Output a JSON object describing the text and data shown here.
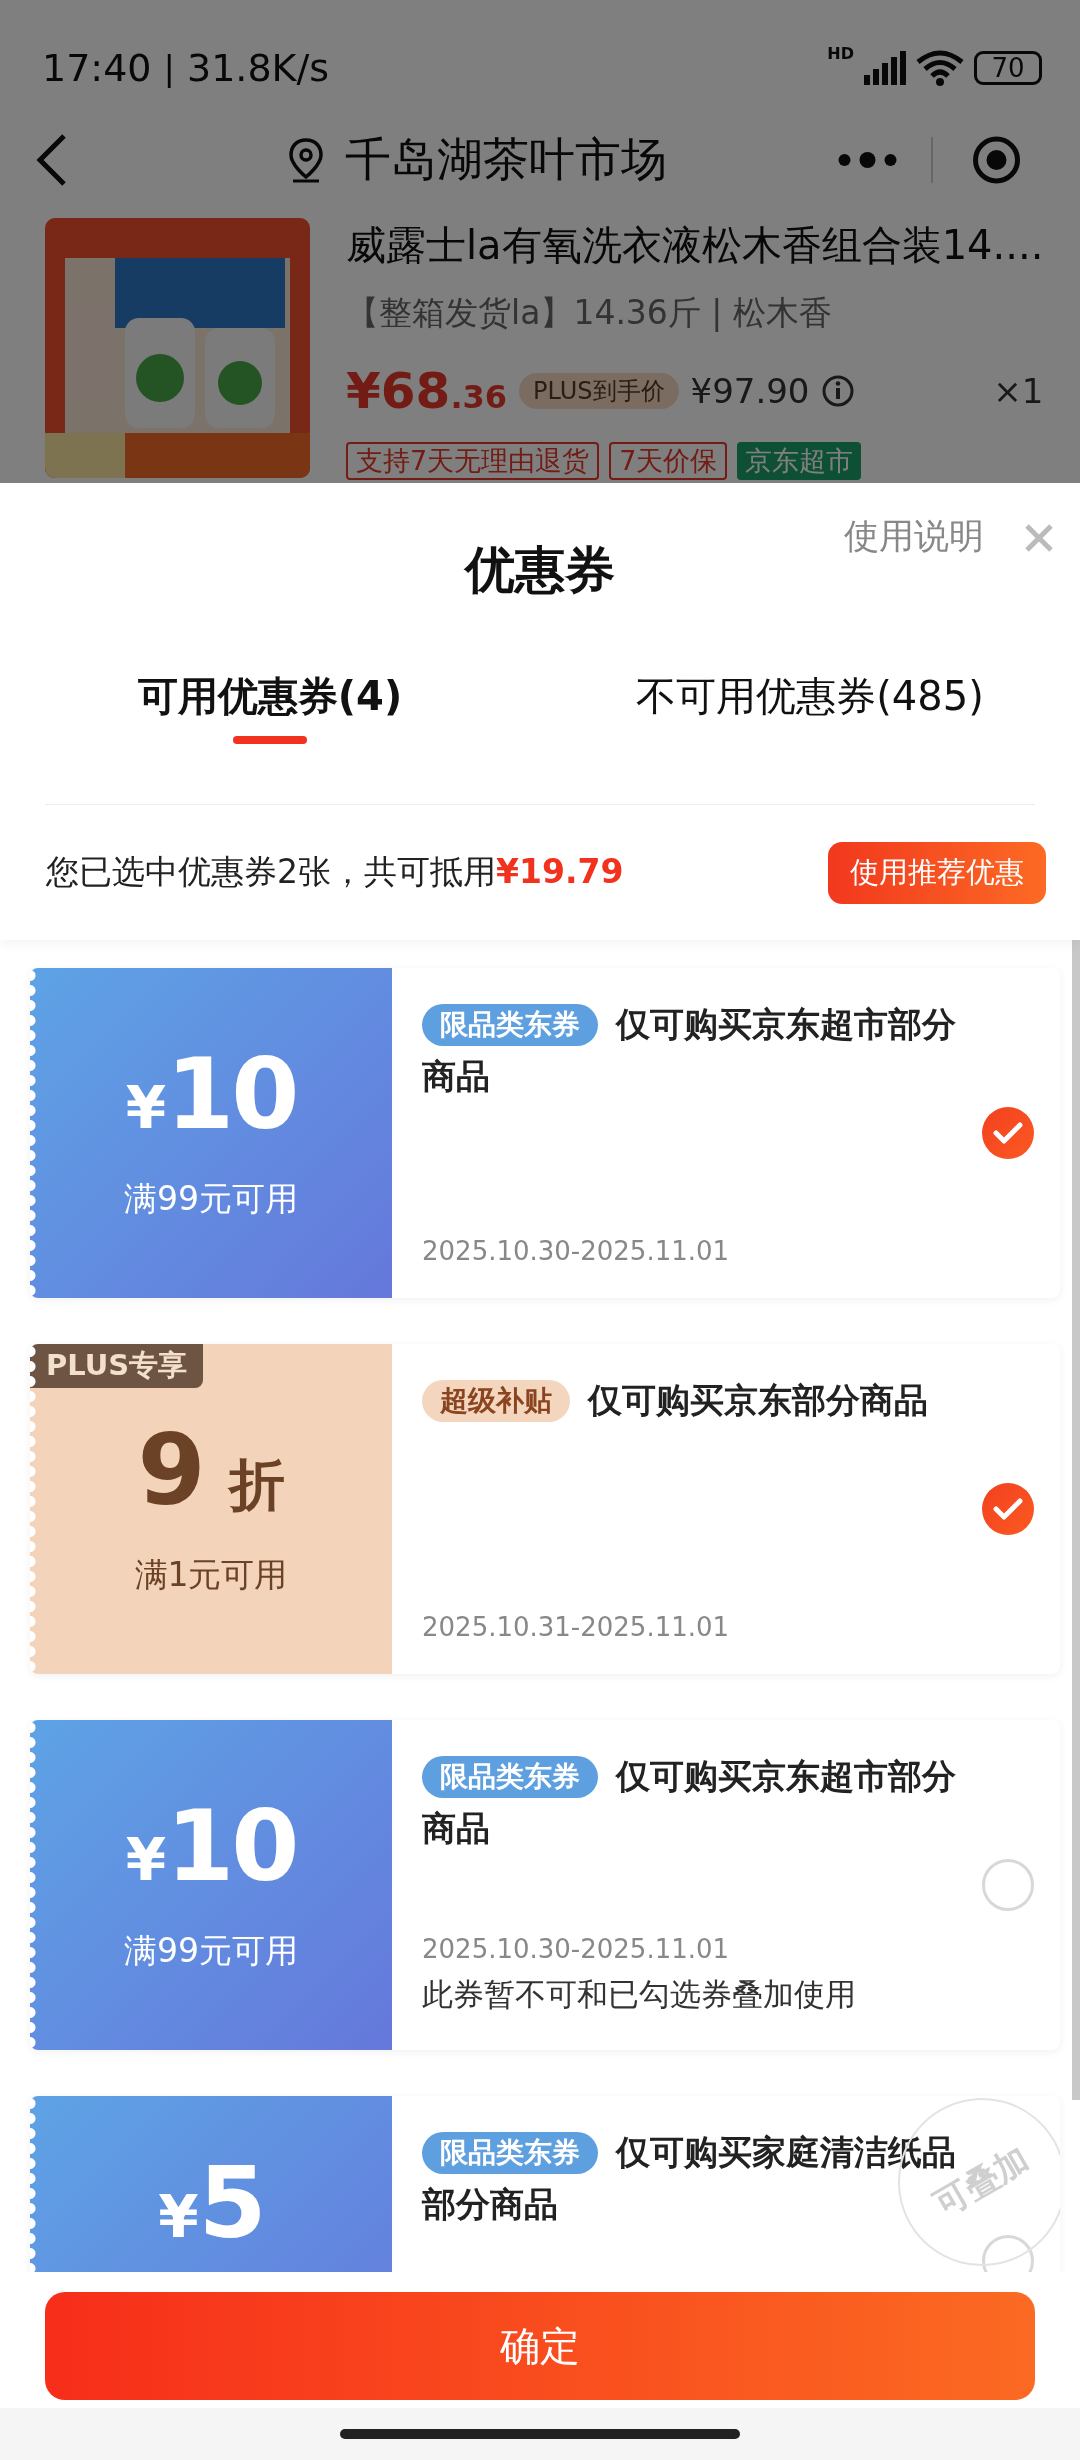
{
  "status_bar": {
    "time": "17:40",
    "separator": "|",
    "speed": "31.8K/s",
    "network_label": "HD",
    "battery": "70"
  },
  "nav": {
    "location": "千岛湖茶叶市场"
  },
  "product": {
    "title": "威露士la有氧洗衣液松木香组合装14....",
    "spec": "【整箱发货la】14.36斤 | 松木香",
    "price": "¥68",
    "price_decimal": ".36",
    "price_label": "PLUS到手价",
    "original_price": "¥97.90",
    "quantity": "×1",
    "tags": [
      {
        "text": "支持7天无理由退货",
        "kind": "outline"
      },
      {
        "text": "7天价保",
        "kind": "outline"
      },
      {
        "text": "京东超市",
        "kind": "filled"
      }
    ]
  },
  "sheet": {
    "title": "优惠券",
    "help": "使用说明",
    "tabs": [
      {
        "label": "可用优惠券(4)",
        "selected": true
      },
      {
        "label": "不可用优惠券(485)",
        "selected": false
      }
    ],
    "summary": {
      "text": "您已选中优惠券2张，共可抵用",
      "amount": "¥19.79",
      "button": "使用推荐优惠"
    }
  },
  "coupons": [
    {
      "kind": "cash",
      "symbol": "¥",
      "value": "10",
      "condition": "满99元可用",
      "tag": {
        "text": "限品类东券",
        "kind": "category"
      },
      "title": "仅可购买京东超市部分商品",
      "date": "2025.10.30-2025.11.01",
      "checked": true
    },
    {
      "kind": "discount",
      "badge": "PLUS专享",
      "value": "9",
      "unit": "折",
      "condition": "满1元可用",
      "tag": {
        "text": "超级补贴",
        "kind": "subsidy"
      },
      "title": "仅可购买京东部分商品",
      "date": "2025.10.31-2025.11.01",
      "checked": true
    },
    {
      "kind": "cash",
      "symbol": "¥",
      "value": "10",
      "condition": "满99元可用",
      "tag": {
        "text": "限品类东券",
        "kind": "category"
      },
      "title": "仅可购买京东超市部分商品",
      "date": "2025.10.30-2025.11.01",
      "note": "此券暂不可和已勾选券叠加使用",
      "checked": false
    },
    {
      "kind": "cash",
      "symbol": "¥",
      "value": "5",
      "tag": {
        "text": "限品类东券",
        "kind": "category"
      },
      "title": "仅可购买家庭清洁纸品部分商品",
      "stamp": "可叠加",
      "checked": false
    }
  ],
  "confirm_button": "确定"
}
